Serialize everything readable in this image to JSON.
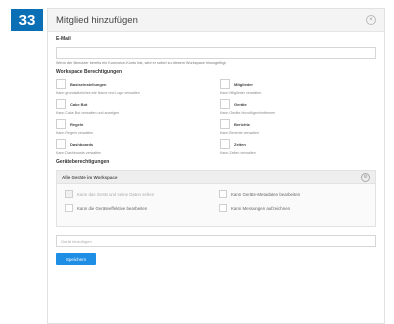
{
  "step_badge": "33",
  "dialog": {
    "title": "Mitglied hinzufügen",
    "close_icon": "close-icon"
  },
  "email": {
    "label": "E-Mail",
    "value": "",
    "help": "Wenn der Benutzer bereits ein Kumvoice-Konto hat, wird er sofort zu diesem Workspace hinzugefügt."
  },
  "workspace_permissions": {
    "title": "Workspace Berechtigungen",
    "items": [
      {
        "name": "Basiseinstellungen",
        "desc": "Kann grundsätzliches wie Name und Logo verwalten"
      },
      {
        "name": "Mitglieder",
        "desc": "Kann Mitglieder verwalten"
      },
      {
        "name": "Cake Bot",
        "desc": "Kann Cake Bot verwalten und anzeigen"
      },
      {
        "name": "Geräte",
        "desc": "Kann Geräte hinzufügen/entfernen"
      },
      {
        "name": "Regeln",
        "desc": "Kann Regeln verwalten"
      },
      {
        "name": "Berichte",
        "desc": "Kann Berichte verwalten"
      },
      {
        "name": "Dashboards",
        "desc": "Kann Dashboards verwalten"
      },
      {
        "name": "Zeiten",
        "desc": "Kann Zeiten verwalten"
      }
    ]
  },
  "device_permissions": {
    "title": "Geräteberechtigungen",
    "box_title": "Alle Geräte im Workspace",
    "settings_icon": "settings-icon",
    "items": [
      {
        "label": "Kann das Gerät und seine Daten sehen",
        "checked": true,
        "disabled": true
      },
      {
        "label": "Kann Geräte-Metadaten bearbeiten",
        "checked": false,
        "disabled": false
      },
      {
        "label": "Kann die Geräteeffektive bearbeiten",
        "checked": false,
        "disabled": false
      },
      {
        "label": "Kann Messungen aufzeichnen",
        "checked": false,
        "disabled": false
      }
    ]
  },
  "add_device": {
    "placeholder": "Gerät hinzufügen"
  },
  "save_label": "Speichern"
}
